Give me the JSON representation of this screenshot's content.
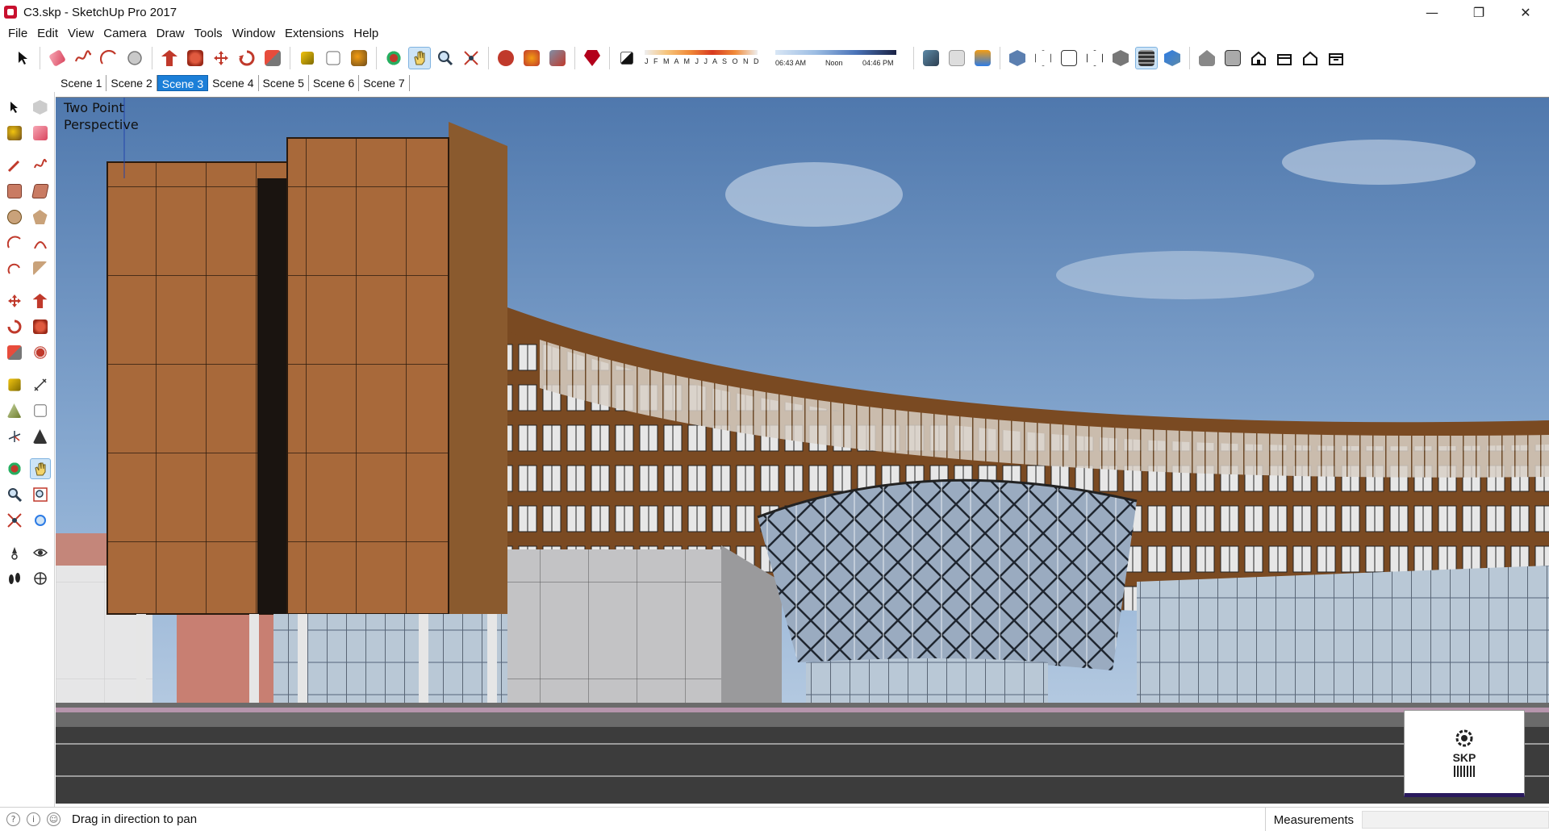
{
  "window": {
    "title": "C3.skp - SketchUp Pro 2017",
    "controls": {
      "minimize": "—",
      "restore": "❐",
      "close": "✕"
    }
  },
  "menu": [
    "File",
    "Edit",
    "View",
    "Camera",
    "Draw",
    "Tools",
    "Window",
    "Extensions",
    "Help"
  ],
  "toolbar": {
    "shadow_months": "J F M A M J J A S O N D",
    "shadow_times": {
      "start": "06:43 AM",
      "mid": "Noon",
      "end": "04:46 PM"
    },
    "active_tool": "pan"
  },
  "scenes": {
    "tabs": [
      "Scene 1",
      "Scene 2",
      "Scene 3",
      "Scene 4",
      "Scene 5",
      "Scene 6",
      "Scene 7"
    ],
    "active": "Scene 3"
  },
  "viewport": {
    "camera_label_line1": "Two Point",
    "camera_label_line2": "Perspective",
    "watermark": "SKP"
  },
  "status": {
    "message": "Drag in direction to pan",
    "measurements_label": "Measurements",
    "measurements_value": ""
  }
}
